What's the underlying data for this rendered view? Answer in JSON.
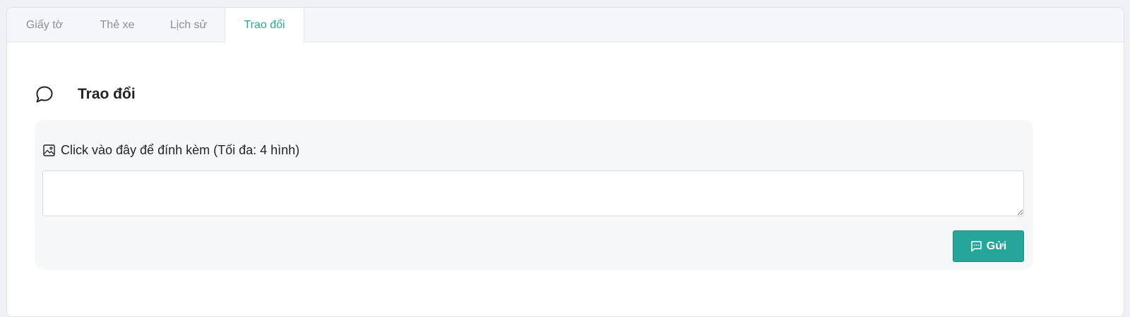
{
  "tabs": [
    {
      "label": "Giấy tờ",
      "active": false
    },
    {
      "label": "Thẻ xe",
      "active": false
    },
    {
      "label": "Lịch sử",
      "active": false
    },
    {
      "label": "Trao đổi",
      "active": true
    }
  ],
  "section": {
    "title": "Trao đổi",
    "icon": "chat-bubble-icon"
  },
  "attachment": {
    "icon": "image-icon",
    "label": "Click vào đây để đính kèm (Tối đa: 4 hình)"
  },
  "message_input": {
    "value": "",
    "placeholder": ""
  },
  "send_button": {
    "icon": "message-icon",
    "label": "Gửi"
  },
  "colors": {
    "accent": "#26a69a",
    "panel_bg": "#f6f7f8",
    "tabbar_bg": "#f4f6f9"
  }
}
